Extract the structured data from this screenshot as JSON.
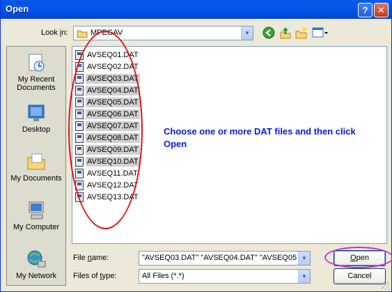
{
  "window": {
    "title": "Open",
    "help_glyph": "?",
    "close_glyph": "✕"
  },
  "look_in": {
    "label_pre": "Look ",
    "label_underlined": "i",
    "label_post": "n:",
    "value": "MPEGAV"
  },
  "toolbar_icons": [
    "back-icon",
    "up-folder-icon",
    "new-folder-icon",
    "views-menu-icon"
  ],
  "places": [
    {
      "label": "My Recent\nDocuments",
      "icon": "recent-documents-icon"
    },
    {
      "label": "Desktop",
      "icon": "desktop-icon"
    },
    {
      "label": "My Documents",
      "icon": "my-documents-icon"
    },
    {
      "label": "My Computer",
      "icon": "my-computer-icon"
    },
    {
      "label": "My Network",
      "icon": "my-network-icon"
    }
  ],
  "files": [
    {
      "name": "AVSEQ01.DAT",
      "selected": false
    },
    {
      "name": "AVSEQ02.DAT",
      "selected": false
    },
    {
      "name": "AVSEQ03.DAT",
      "selected": true
    },
    {
      "name": "AVSEQ04.DAT",
      "selected": true
    },
    {
      "name": "AVSEQ05.DAT",
      "selected": true
    },
    {
      "name": "AVSEQ06.DAT",
      "selected": true
    },
    {
      "name": "AVSEQ07.DAT",
      "selected": true
    },
    {
      "name": "AVSEQ08.DAT",
      "selected": true
    },
    {
      "name": "AVSEQ09.DAT",
      "selected": true
    },
    {
      "name": "AVSEQ10.DAT",
      "selected": true
    },
    {
      "name": "AVSEQ11.DAT",
      "selected": false
    },
    {
      "name": "AVSEQ12.DAT",
      "selected": false
    },
    {
      "name": "AVSEQ13.DAT",
      "selected": false
    }
  ],
  "instruction": "Choose one or more DAT files and then click Open",
  "file_name": {
    "label_pre": "File ",
    "label_underlined": "n",
    "label_post": "ame:",
    "value": "\"AVSEQ03.DAT\" \"AVSEQ04.DAT\" \"AVSEQ05"
  },
  "files_of_type": {
    "label_pre": "Files of ",
    "label_underlined": "t",
    "label_post": "ype:",
    "value": "All Files (*.*)"
  },
  "buttons": {
    "open_underlined": "O",
    "open_rest": "pen",
    "cancel": "Cancel"
  },
  "annotation_colors": {
    "file_list_ellipse": "#e01010",
    "open_button_ellipse": "#d42ad4"
  }
}
